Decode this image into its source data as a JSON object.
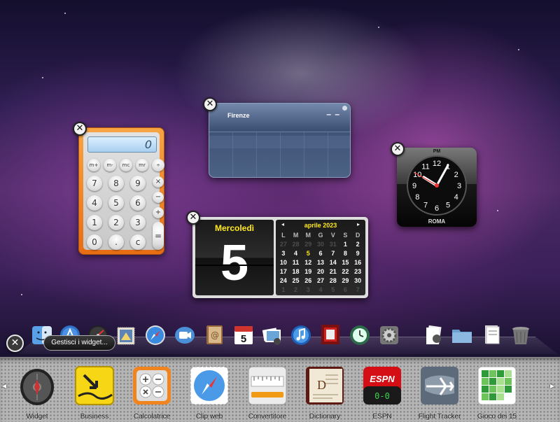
{
  "calculator": {
    "display": "0",
    "memory_keys": [
      "m+",
      "m-",
      "mc",
      "mr"
    ],
    "digit_rows": [
      [
        "7",
        "8",
        "9"
      ],
      [
        "4",
        "5",
        "6"
      ],
      [
        "1",
        "2",
        "3"
      ],
      [
        "0",
        ".",
        "c"
      ]
    ],
    "operators": [
      "÷",
      "×",
      "−",
      "+"
    ],
    "equals": "="
  },
  "weather": {
    "city": "Firenze",
    "temp": "– –"
  },
  "clock": {
    "ampm": "PM",
    "city": "ROMA",
    "hour": 10,
    "minute": 4,
    "second": 50,
    "numbers": [
      "12",
      "1",
      "2",
      "3",
      "4",
      "5",
      "6",
      "7",
      "8",
      "9",
      "10",
      "11"
    ]
  },
  "calendar": {
    "day_name": "Mercoledì",
    "day_number": "5",
    "month_header": "aprile 2023",
    "prev": "◂",
    "next": "▸",
    "weekdays": [
      "L",
      "M",
      "M",
      "G",
      "V",
      "S",
      "D"
    ],
    "days": [
      {
        "d": "27",
        "dim": true
      },
      {
        "d": "28",
        "dim": true
      },
      {
        "d": "29",
        "dim": true
      },
      {
        "d": "30",
        "dim": true
      },
      {
        "d": "31",
        "dim": true
      },
      {
        "d": "1"
      },
      {
        "d": "2"
      },
      {
        "d": "3"
      },
      {
        "d": "4"
      },
      {
        "d": "5",
        "today": true
      },
      {
        "d": "6"
      },
      {
        "d": "7"
      },
      {
        "d": "8"
      },
      {
        "d": "9"
      },
      {
        "d": "10"
      },
      {
        "d": "11"
      },
      {
        "d": "12"
      },
      {
        "d": "13"
      },
      {
        "d": "14"
      },
      {
        "d": "15"
      },
      {
        "d": "16"
      },
      {
        "d": "17"
      },
      {
        "d": "18"
      },
      {
        "d": "19"
      },
      {
        "d": "20"
      },
      {
        "d": "21"
      },
      {
        "d": "22"
      },
      {
        "d": "23"
      },
      {
        "d": "24"
      },
      {
        "d": "25"
      },
      {
        "d": "26"
      },
      {
        "d": "27"
      },
      {
        "d": "28"
      },
      {
        "d": "29"
      },
      {
        "d": "30"
      },
      {
        "d": "1",
        "dim": true
      },
      {
        "d": "2",
        "dim": true
      },
      {
        "d": "3",
        "dim": true
      },
      {
        "d": "4",
        "dim": true
      },
      {
        "d": "5",
        "dim": true
      },
      {
        "d": "6",
        "dim": true
      },
      {
        "d": "7",
        "dim": true
      }
    ]
  },
  "dock": {
    "icons": [
      "finder-icon",
      "app-store-icon",
      "dashboard-icon",
      "mail-stamp-icon",
      "safari-icon",
      "facetime-icon",
      "address-book-icon",
      "ical-icon",
      "iphoto-icon",
      "itunes-icon",
      "photo-booth-icon",
      "time-machine-icon",
      "system-preferences-icon",
      "preview-stack-icon",
      "applications-folder-icon",
      "documents-stack-icon",
      "trash-icon"
    ],
    "ical_date": "5"
  },
  "close_all": "✕",
  "manage_widgets_label": "Gestisci i widget...",
  "widget_bar": {
    "items": [
      {
        "label": "Widget",
        "icon": "widget-browser-icon"
      },
      {
        "label": "Business",
        "icon": "business-icon"
      },
      {
        "label": "Calcolatrice",
        "icon": "calculator-icon"
      },
      {
        "label": "Clip web",
        "icon": "web-clip-icon"
      },
      {
        "label": "Convertitore",
        "icon": "unit-converter-icon"
      },
      {
        "label": "Dictionary",
        "icon": "dictionary-icon"
      },
      {
        "label": "ESPN",
        "icon": "espn-icon"
      },
      {
        "label": "Flight Tracker",
        "icon": "flight-tracker-icon"
      },
      {
        "label": "Gioco dei 15",
        "icon": "tile-game-icon"
      }
    ],
    "prev_arrow": "◂",
    "next_arrow": "▸",
    "espn_text": "ESPN",
    "espn_score": "0-0",
    "dict_text": "D"
  },
  "close_glyph": "✕"
}
